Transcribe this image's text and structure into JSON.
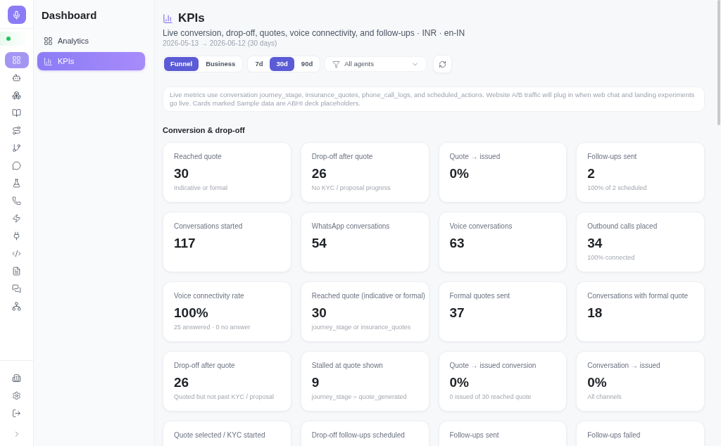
{
  "rail": {
    "items": [
      {
        "selected": true
      },
      {
        "selected": false
      },
      {
        "selected": false
      },
      {
        "selected": false
      },
      {
        "selected": false
      },
      {
        "selected": false
      },
      {
        "selected": false
      },
      {
        "selected": false
      },
      {
        "selected": false
      },
      {
        "selected": false
      },
      {
        "selected": false
      },
      {
        "selected": false
      },
      {
        "selected": false
      },
      {
        "selected": false
      },
      {
        "selected": false
      }
    ]
  },
  "sidebar": {
    "title": "Dashboard",
    "items": [
      {
        "label": "Analytics",
        "selected": false
      },
      {
        "label": "KPIs",
        "selected": true
      }
    ]
  },
  "header": {
    "title": "KPIs",
    "subtitle": "Live conversion, drop-off, quotes, voice connectivity, and follow-ups · INR · en-IN",
    "date_range": "2026-05-13 → 2026-06-12 (30 days)"
  },
  "view_tabs": [
    {
      "label": "Funnel",
      "selected": true
    },
    {
      "label": "Business",
      "selected": false
    }
  ],
  "period_tabs": [
    {
      "label": "7d",
      "selected": false
    },
    {
      "label": "30d",
      "selected": true
    },
    {
      "label": "90d",
      "selected": false
    }
  ],
  "agent_filter": {
    "value": "All agents"
  },
  "note": "Live metrics use conversation journey_stage, insurance_quotes, phone_call_logs, and scheduled_actions. Website A/B traffic will plug in when web chat and landing experiments go live. Cards marked Sample data are ABHI deck placeholders.",
  "section": {
    "title": "Conversion & drop-off",
    "cards": [
      {
        "label": "Reached quote",
        "value": "30",
        "note": "Indicative or formal"
      },
      {
        "label": "Drop-off after quote",
        "value": "26",
        "note": "No KYC / proposal progress"
      },
      {
        "label": "Quote → issued",
        "value": "0%"
      },
      {
        "label": "Follow-ups sent",
        "value": "2",
        "note": "100% of 2 scheduled"
      },
      {
        "label": "Conversations started",
        "value": "117"
      },
      {
        "label": "WhatsApp conversations",
        "value": "54"
      },
      {
        "label": "Voice conversations",
        "value": "63"
      },
      {
        "label": "Outbound calls placed",
        "value": "34",
        "note": "100% connected"
      },
      {
        "label": "Voice connectivity rate",
        "value": "100%",
        "note": "25 answered · 0 no answer"
      },
      {
        "label": "Reached quote (indicative or formal)",
        "value": "30",
        "note": "journey_stage or insurance_quotes"
      },
      {
        "label": "Formal quotes sent",
        "value": "37"
      },
      {
        "label": "Conversations with formal quote",
        "value": "18"
      },
      {
        "label": "Drop-off after quote",
        "value": "26",
        "note": "Quoted but not past KYC / proposal"
      },
      {
        "label": "Stalled at quote shown",
        "value": "9",
        "note": "journey_stage = quote_generated"
      },
      {
        "label": "Quote → issued conversion",
        "value": "0%",
        "note": "0 issued of 30 reached quote"
      },
      {
        "label": "Conversation → issued",
        "value": "0%",
        "note": "All channels"
      },
      {
        "label": "Quote selected / KYC started"
      },
      {
        "label": "Drop-off follow-ups scheduled"
      },
      {
        "label": "Follow-ups sent"
      },
      {
        "label": "Follow-ups failed"
      }
    ]
  }
}
